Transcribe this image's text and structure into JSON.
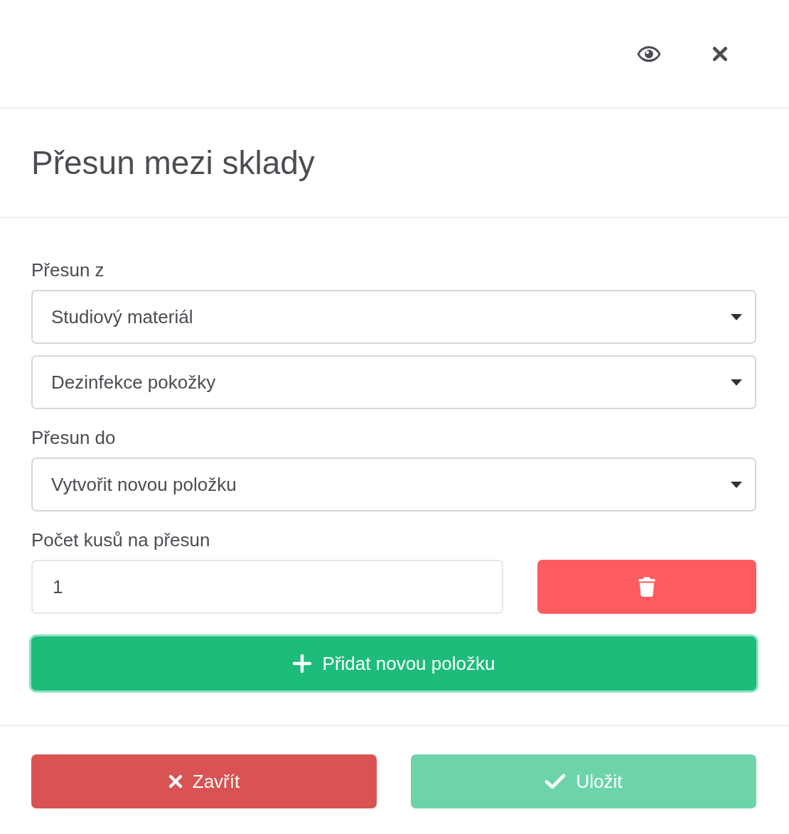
{
  "title": "Přesun mezi sklady",
  "form": [
    {
      "kind": "label",
      "text": "Přesun z"
    },
    {
      "kind": "select",
      "value": "Studiový materiál"
    },
    {
      "kind": "select",
      "value": "Dezinfekce pokožky"
    },
    {
      "kind": "label",
      "text": "Přesun do"
    },
    {
      "kind": "select",
      "value": "Vytvořit novou položku"
    },
    {
      "kind": "label",
      "text": "Počet kusů na přesun"
    }
  ],
  "quantity": {
    "value": "1"
  },
  "add_button": {
    "label": "Přidat novou položku",
    "focused": true
  },
  "footer": {
    "buttons": [
      {
        "kind": "close",
        "label": "Zavřít",
        "disabled": false
      },
      {
        "kind": "save",
        "label": "Uložit",
        "disabled": true
      }
    ]
  }
}
